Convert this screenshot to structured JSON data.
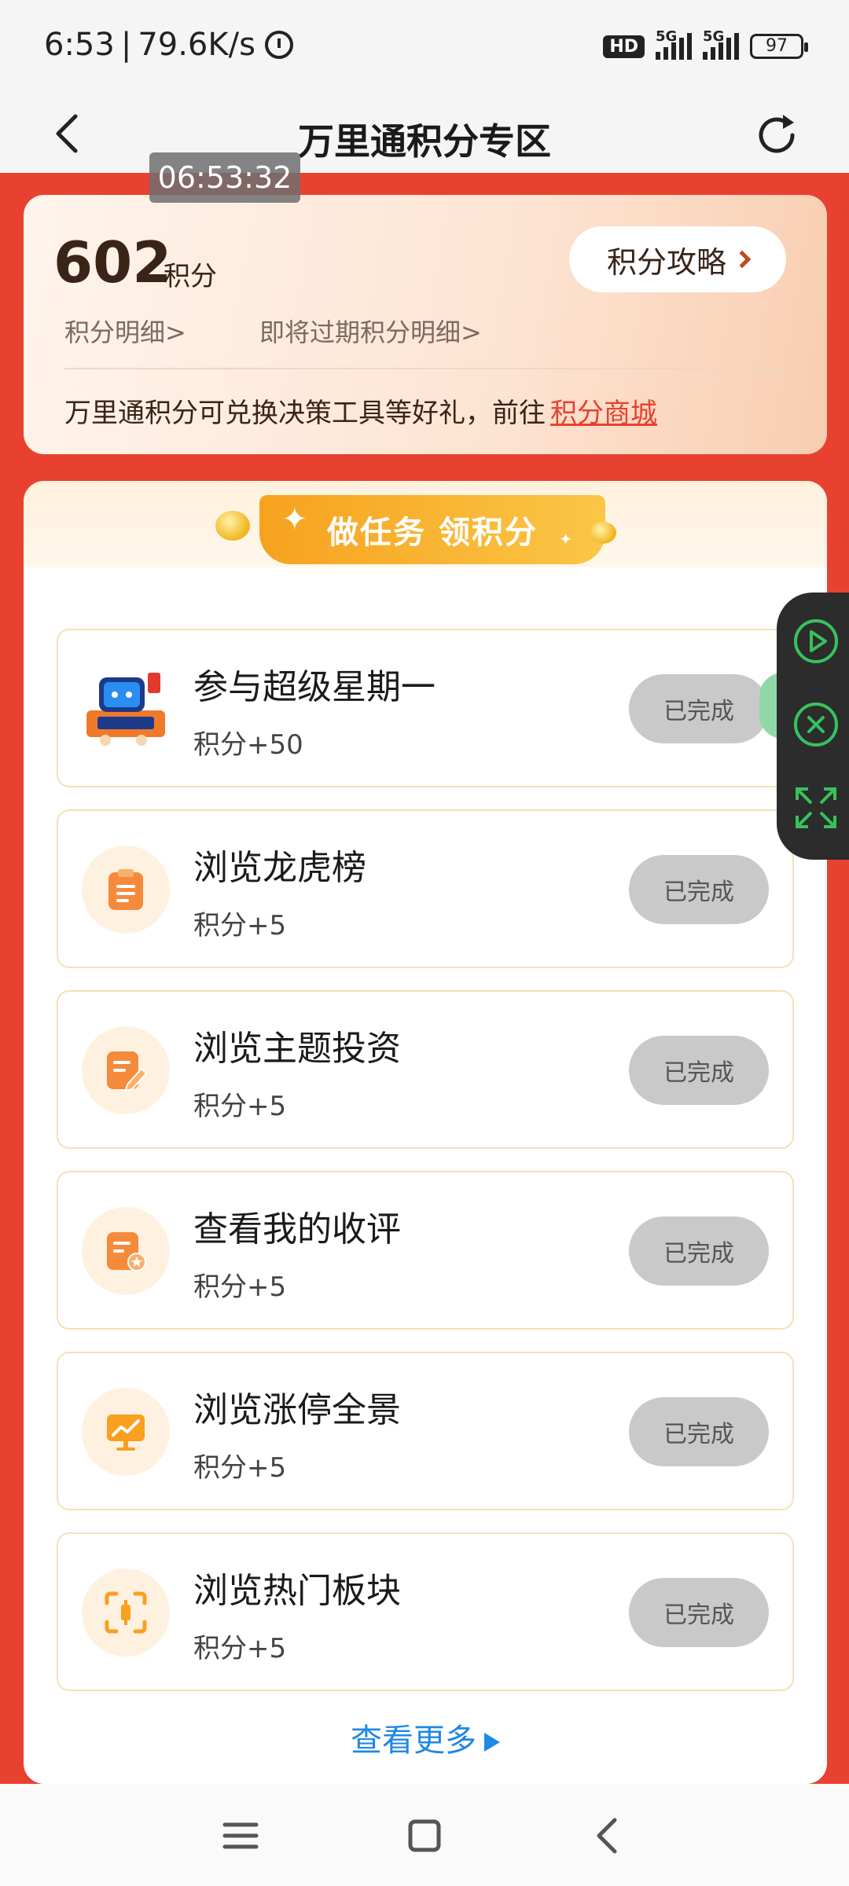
{
  "status_bar": {
    "time": "6:53",
    "net_speed": "79.6K/s",
    "hd_badge": "HD",
    "network": "5G",
    "battery": "97"
  },
  "nav": {
    "title": "万里通积分专区",
    "back_icon": "back-chevron-icon",
    "refresh_icon": "refresh-icon"
  },
  "timestamp": "06:53:32",
  "points": {
    "value": "602",
    "unit": "积分",
    "guide_label": "积分攻略",
    "detail_link": "积分明细>",
    "expiring_link": "即将过期积分明细>",
    "promo_text": "万里通积分可兑换决策工具等好礼，前往",
    "promo_link": "积分商城"
  },
  "tasks": {
    "banner": "做任务 领积分",
    "items": [
      {
        "title": "参与超级星期一",
        "reward": "积分+50",
        "status": "已完成",
        "icon": "super-monday-icon"
      },
      {
        "title": "浏览龙虎榜",
        "reward": "积分+5",
        "status": "已完成",
        "icon": "clipboard-icon"
      },
      {
        "title": "浏览主题投资",
        "reward": "积分+5",
        "status": "已完成",
        "icon": "edit-document-icon"
      },
      {
        "title": "查看我的收评",
        "reward": "积分+5",
        "status": "已完成",
        "icon": "review-document-icon"
      },
      {
        "title": "浏览涨停全景",
        "reward": "积分+5",
        "status": "已完成",
        "icon": "trend-chart-icon"
      },
      {
        "title": "浏览热门板块",
        "reward": "积分+5",
        "status": "已完成",
        "icon": "focus-frame-icon"
      }
    ],
    "see_more": "查看更多"
  },
  "colors": {
    "brand_red": "#e8412f",
    "link_blue": "#1e88e5",
    "done_gray": "#c9c9c9",
    "accent_orange": "#f6a21f"
  }
}
